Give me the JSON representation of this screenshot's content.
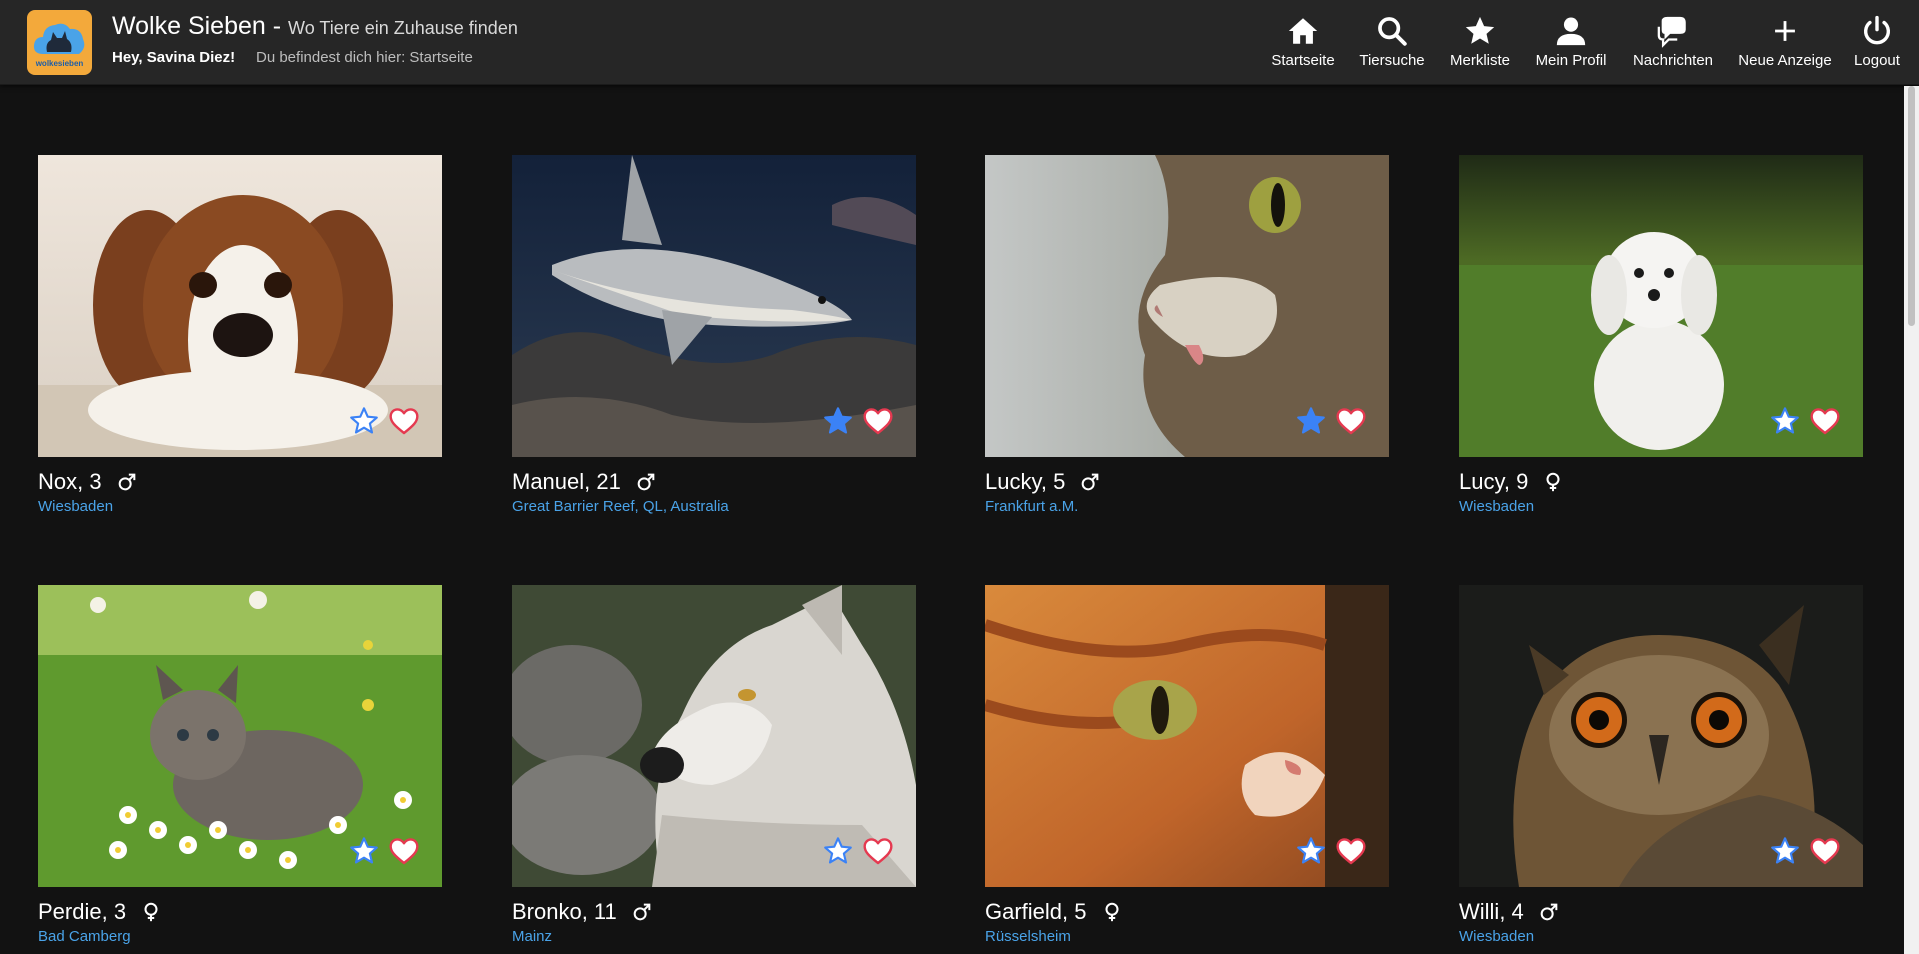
{
  "header": {
    "logo_text": "wolkesieben",
    "title": "Wolke Sieben -",
    "subtitle": "Wo Tiere ein Zuhause finden",
    "greeting": "Hey, Savina Diez!",
    "breadcrumb": "Du befindest dich hier: Startseite"
  },
  "nav": [
    {
      "label": "Startseite",
      "icon": "home-icon"
    },
    {
      "label": "Tiersuche",
      "icon": "search-icon"
    },
    {
      "label": "Merkliste",
      "icon": "star-icon"
    },
    {
      "label": "Mein Profil",
      "icon": "user-icon"
    },
    {
      "label": "Nachrichten",
      "icon": "chat-icon"
    },
    {
      "label": "Neue Anzeige",
      "icon": "plus-icon"
    },
    {
      "label": "Logout",
      "icon": "power-icon"
    }
  ],
  "colors": {
    "accent_blue": "#4aa3e8",
    "star_blue": "#3b82f6",
    "heart_red": "#e53950",
    "header_bg": "#262626",
    "page_bg": "#121212",
    "logo_orange": "#f3a93b"
  },
  "animals": [
    {
      "name": "Nox, 3",
      "gender": "male",
      "location": "Wiesbaden",
      "starred": false,
      "photo": "dog-photo"
    },
    {
      "name": "Manuel, 21",
      "gender": "male",
      "location": "Great Barrier Reef, QL, Australia",
      "starred": true,
      "photo": "shark-photo"
    },
    {
      "name": "Lucky, 5",
      "gender": "male",
      "location": "Frankfurt a.M.",
      "starred": true,
      "photo": "cat-photo"
    },
    {
      "name": "Lucy, 9",
      "gender": "female",
      "location": "Wiesbaden",
      "starred": false,
      "photo": "white-dog-photo"
    },
    {
      "name": "Perdie, 3",
      "gender": "female",
      "location": "Bad Camberg",
      "starred": false,
      "photo": "kitten-photo"
    },
    {
      "name": "Bronko, 11",
      "gender": "male",
      "location": "Mainz",
      "starred": false,
      "photo": "wolf-photo"
    },
    {
      "name": "Garfield, 5",
      "gender": "female",
      "location": "Rüsselsheim",
      "starred": false,
      "photo": "orange-cat-photo"
    },
    {
      "name": "Willi, 4",
      "gender": "male",
      "location": "Wiesbaden",
      "starred": false,
      "photo": "owl-photo"
    }
  ]
}
